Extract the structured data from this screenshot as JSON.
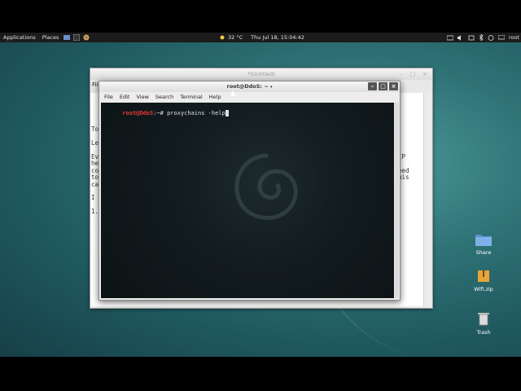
{
  "panel": {
    "applications": "Applications",
    "places": "Places",
    "weather": "32 °C",
    "clock": "Thu Jul 18, 15:04:42",
    "user": "root"
  },
  "editor": {
    "title": "*(Untitled)",
    "menu_first": "File",
    "lines": [
      "Too",
      "Let",
      "Eve",
      "hea",
      "cor",
      "to",
      "can",
      "I T",
      "1."
    ],
    "right_fragments": [
      "IP",
      "eed",
      "his"
    ]
  },
  "terminal": {
    "title": "root@DdoS: ~",
    "menu": [
      "File",
      "Edit",
      "View",
      "Search",
      "Terminal",
      "Help"
    ],
    "prompt_user": "root@DdoS",
    "prompt_rest": ":~# ",
    "command": "proxychains -help"
  },
  "desktop_icons": [
    {
      "label": "Share",
      "icon": "folder-icon"
    },
    {
      "label": "Wifi.zip",
      "icon": "zip-icon"
    },
    {
      "label": "Trash",
      "icon": "trash-icon"
    }
  ],
  "colors": {
    "desktop": "#2f7377",
    "terminal_bg": "#121b1e",
    "prompt_red": "#e53935",
    "panel": "#1b1b1b"
  }
}
